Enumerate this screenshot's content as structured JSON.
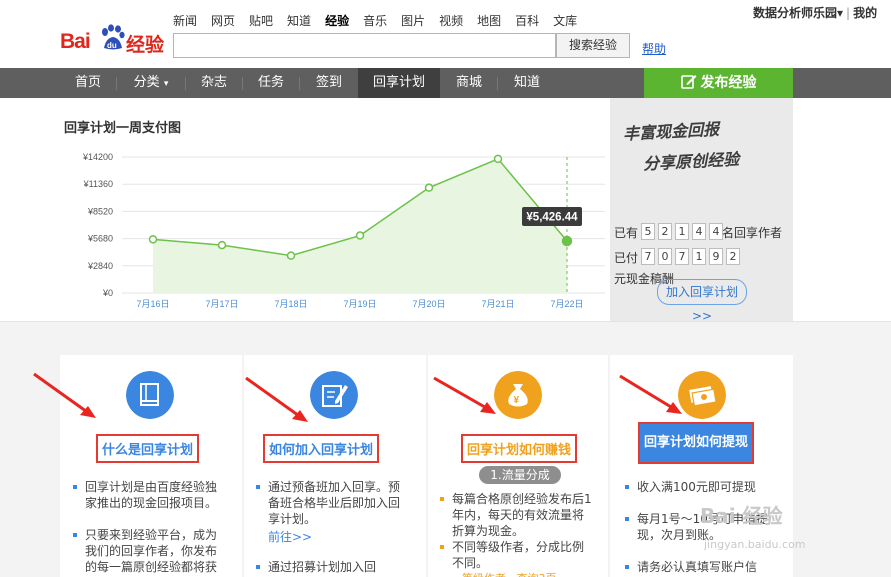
{
  "header": {
    "logo_text_1": "Bai",
    "logo_text_2": "经验",
    "top_links": [
      "新闻",
      "网页",
      "贴吧",
      "知道",
      "经验",
      "音乐",
      "图片",
      "视频",
      "地图",
      "百科",
      "文库"
    ],
    "active_top_link": "经验",
    "search_placeholder": "",
    "search_button": "搜索经验",
    "help_link": "帮助",
    "user_name": "数据分析师乐园",
    "user_caret": "▾",
    "user_sep": "|",
    "user_extra": "我的"
  },
  "nav": {
    "items": [
      "首页",
      "分类",
      "杂志",
      "任务",
      "签到",
      "回享计划",
      "商城",
      "知道"
    ],
    "active": "回享计划",
    "category_caret": "▾",
    "publish_label": "发布经验"
  },
  "chart": {
    "title": "回享计划一周支付图",
    "tooltip": "¥5,426.44"
  },
  "chart_data": {
    "type": "area",
    "title": "回享计划一周支付图",
    "categories": [
      "7月16日",
      "7月17日",
      "7月18日",
      "7月19日",
      "7月20日",
      "7月21日",
      "7月22日"
    ],
    "y_ticks": [
      "¥0",
      "¥2840",
      "¥5680",
      "¥8520",
      "¥11360",
      "¥14200"
    ],
    "ylim": [
      0,
      14200
    ],
    "values": [
      5600,
      5000,
      3900,
      6000,
      11000,
      14000,
      5426.44
    ],
    "highlight_index": 6,
    "grid": true,
    "color": "#6cc24a"
  },
  "promo": {
    "handwriting_1": "丰富现金回报",
    "handwriting_2": "分享原创经验",
    "authors_prefix": "已有",
    "authors_digits": [
      "5",
      "2",
      "1",
      "4",
      "4"
    ],
    "authors_suffix": "名回享作者",
    "paid_prefix": "已付",
    "paid_digits": [
      "7",
      "0",
      "7",
      "1",
      "9",
      "2"
    ],
    "paid_suffix": "元现金稿酬",
    "join_button": "加入回享计划>>"
  },
  "cards": [
    {
      "title": "什么是回享计划",
      "icon": "book-icon",
      "color": "#3a86e0",
      "bullets": [
        "回享计划是由百度经验独家推出的现金回报项目。",
        "只要来到经验平台，成为我们的回享作者，你发布的每一篇原创经验都将获"
      ]
    },
    {
      "title": "如何加入回享计划",
      "icon": "edit-icon",
      "color": "#3a86e0",
      "bullets": [
        "通过预备班加入回享。预备班合格毕业后即加入回享计划。",
        "通过招募计划加入回"
      ],
      "link": "前往>>"
    },
    {
      "title": "回享计划如何赚钱",
      "icon": "money-bag-icon",
      "color": "#f0a21f",
      "pill": "1.流量分成",
      "bullets": [
        "每篇合格原创经验发布后1年内，每天的有效流量将折算为现金。",
        "不同等级作者，分成比例不同。"
      ],
      "cut_text": "等级作者 · 查询3页"
    },
    {
      "title": "回享计划如何提现",
      "icon": "cash-icon",
      "color": "#f0a21f",
      "bullets": [
        "收入满100元即可提现",
        "每月1号～10号可申请提现，次月到账。",
        "请务必认真填写账户信"
      ]
    }
  ],
  "watermark": {
    "text": "Bai 经验",
    "url": "jingyan.baidu.com"
  }
}
